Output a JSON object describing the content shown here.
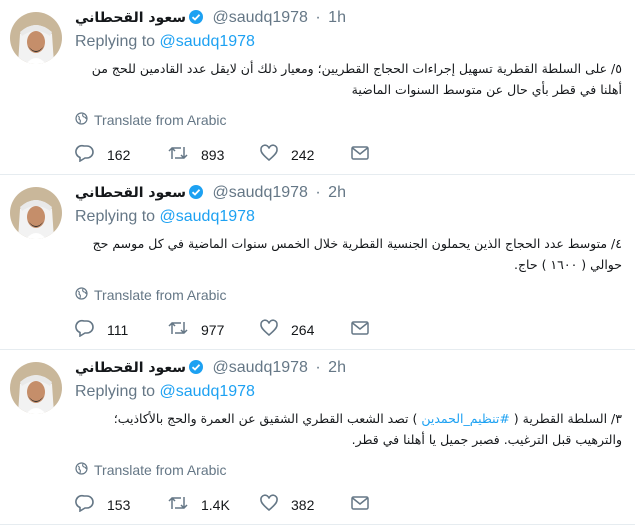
{
  "tweets": [
    {
      "name": "سعود القحطاني",
      "handle": "@saudq1978",
      "separator": "·",
      "time": "1h",
      "replying_prefix": "Replying to ",
      "replying_to": "@saudq1978",
      "text": "٥/ على السلطة القطرية  تسهيل إجراءات الحجاج القطريين؛ ومعيار ذلك أن لايقل عدد القادمين للحج  من أهلنا في قطر بأي حال عن متوسط السنوات الماضية",
      "translate": "Translate from Arabic",
      "reply_count": "162",
      "retweet_count": "893",
      "like_count": "242"
    },
    {
      "name": "سعود القحطاني",
      "handle": "@saudq1978",
      "separator": "·",
      "time": "2h",
      "replying_prefix": "Replying to ",
      "replying_to": "@saudq1978",
      "text": "٤/ متوسط عدد الحجاج الذين يحملون الجنسية القطرية خلال الخمس سنوات الماضية في كل موسم حج  حوالي  ( ١٦٠٠ ) حاج.",
      "translate": "Translate from Arabic",
      "reply_count": "111",
      "retweet_count": "977",
      "like_count": "264"
    },
    {
      "name": "سعود القحطاني",
      "handle": "@saudq1978",
      "separator": "·",
      "time": "2h",
      "replying_prefix": "Replying to ",
      "replying_to": "@saudq1978",
      "text_before": "٣/ السلطة القطرية ( ",
      "hashtag": "#تنظيم_الحمدين",
      "text_after": " ) تصد الشعب القطري الشقيق عن العمرة والحج بالأكاذيب؛ والترهيب قبل الترغيب. فصبر جميل يا أهلنا في قطر.",
      "translate": "Translate from Arabic",
      "reply_count": "153",
      "retweet_count": "1.4K",
      "like_count": "382"
    }
  ],
  "colors": {
    "link": "#1da1f2",
    "muted": "#657786",
    "text": "#14171a",
    "divider": "#e6ecf0"
  },
  "icons": [
    "verified-badge-icon",
    "globe-icon",
    "reply-icon",
    "retweet-icon",
    "like-icon",
    "message-icon"
  ]
}
